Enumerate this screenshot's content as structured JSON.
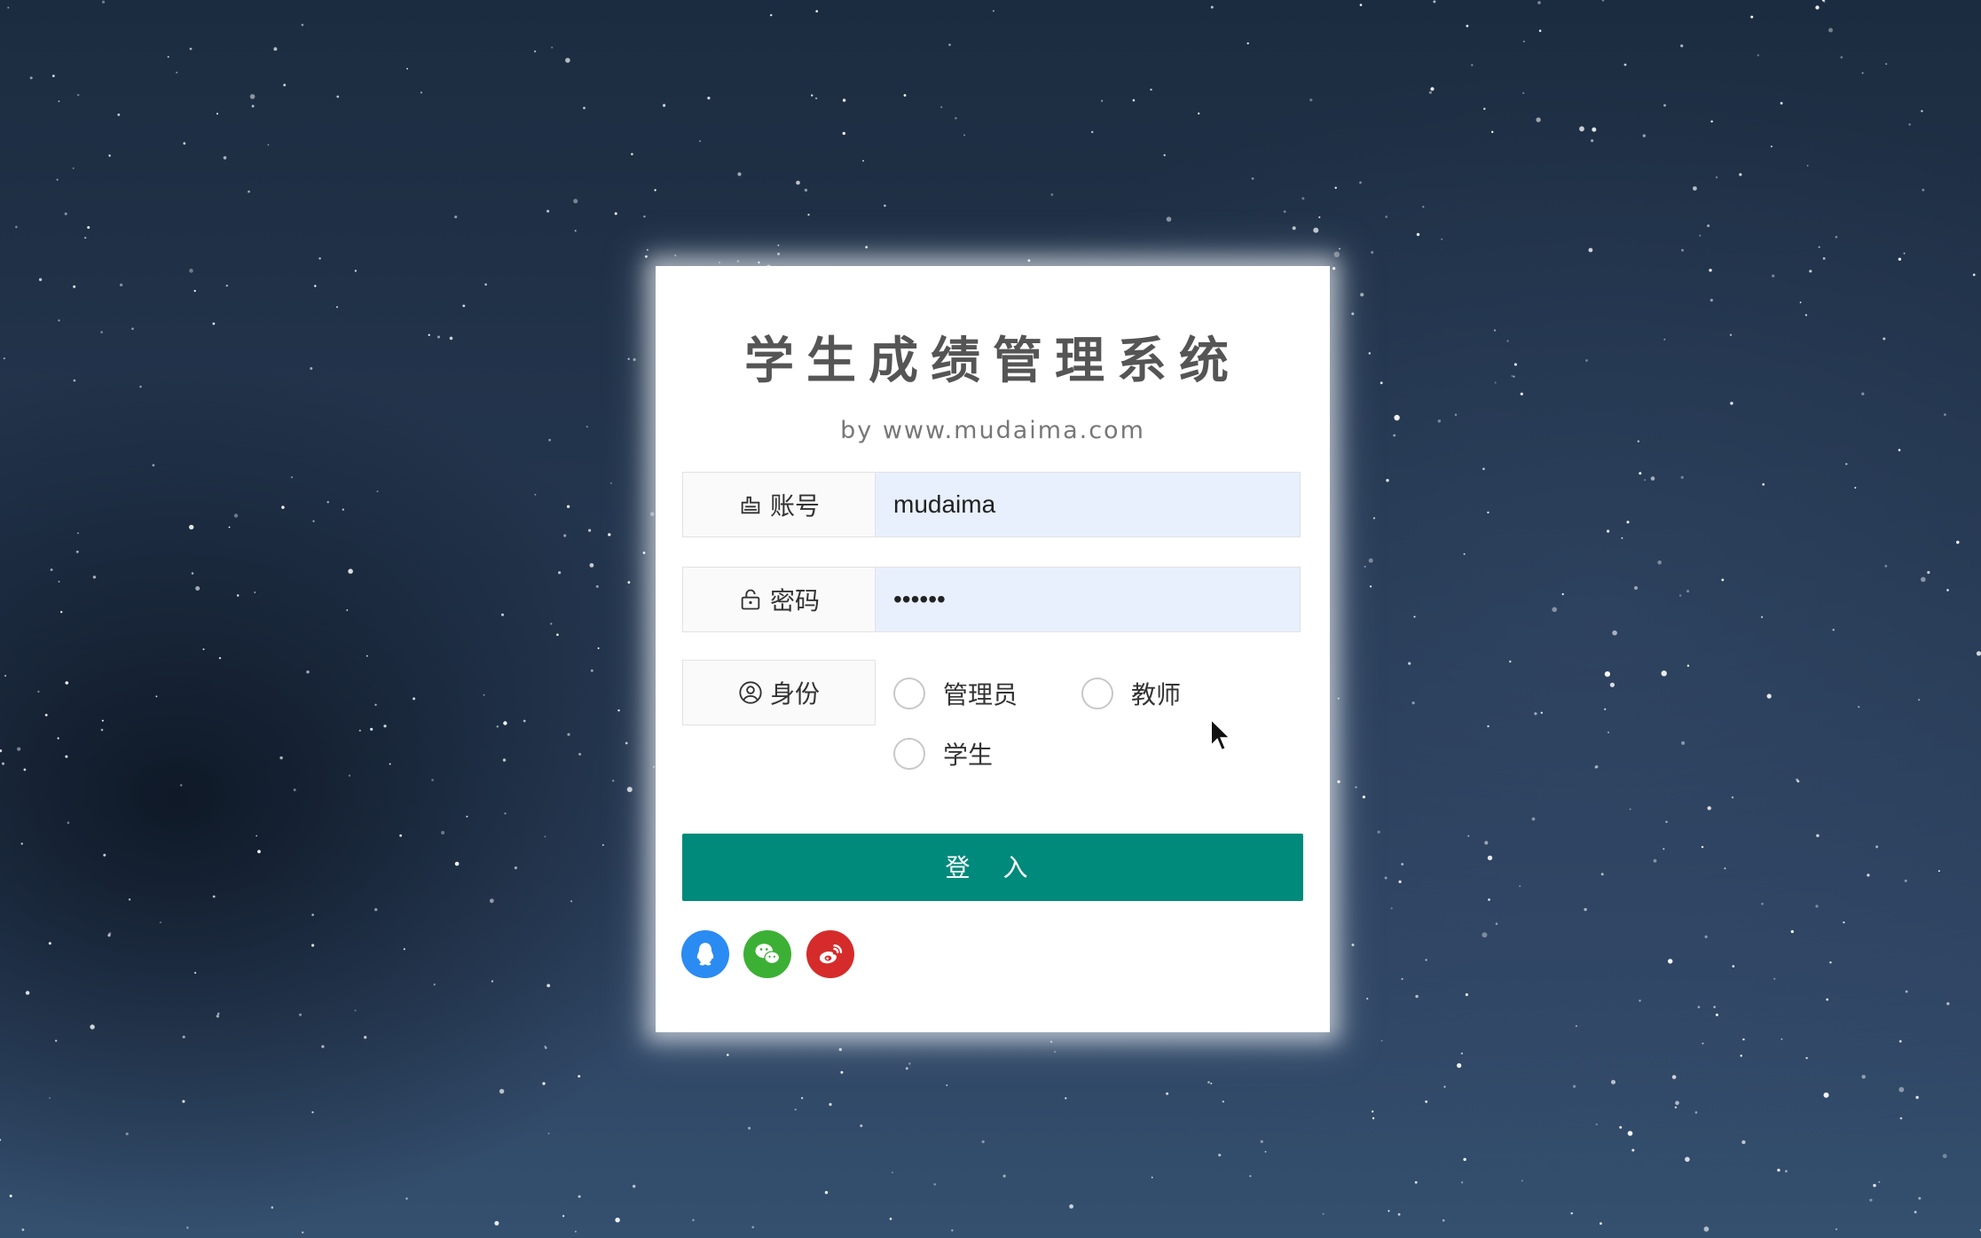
{
  "login_card": {
    "title": "学生成绩管理系统",
    "subtitle": "by www.mudaima.com",
    "account": {
      "label": "账号",
      "icon": "account-icon",
      "value": "mudaima"
    },
    "password": {
      "label": "密码",
      "icon": "lock-icon",
      "value": "••••••"
    },
    "role": {
      "label": "身份",
      "icon": "user-circle-icon",
      "options": [
        "管理员",
        "教师",
        "学生"
      ]
    },
    "login_button": "登 入",
    "social_logins": [
      {
        "name": "qq-icon",
        "color": "#2a8bf2"
      },
      {
        "name": "wechat-icon",
        "color": "#3cb034"
      },
      {
        "name": "weibo-icon",
        "color": "#d52c2b"
      }
    ]
  },
  "colors": {
    "primary_button": "#008a7b",
    "input_background": "#e8f0fe",
    "title_text": "#555555"
  }
}
